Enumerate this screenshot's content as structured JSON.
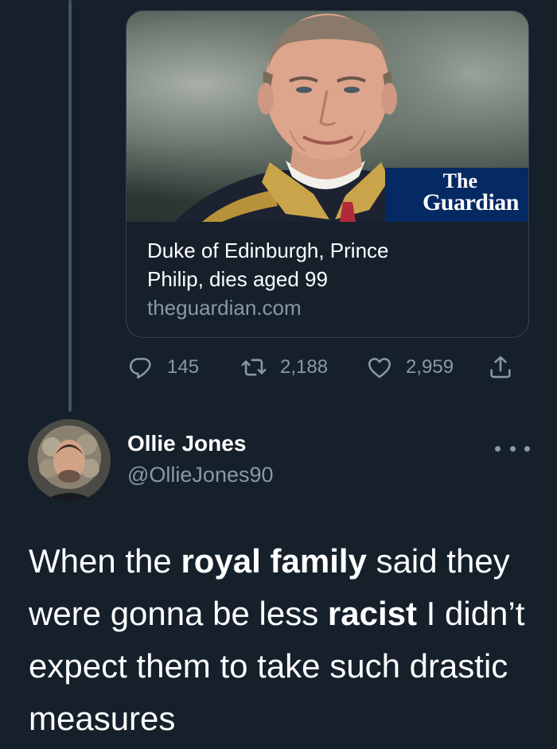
{
  "link_card": {
    "title_line1": "Duke of Edinburgh, Prince",
    "title_line2": "Philip, dies aged 99",
    "domain": "theguardian.com",
    "logo_the": "The",
    "logo_guardian": "Guardian",
    "logo_color": "#052962"
  },
  "actions": {
    "reply_count": "145",
    "retweet_count": "2,188",
    "like_count": "2,959",
    "icons": [
      "reply-icon",
      "retweet-icon",
      "like-icon",
      "share-icon"
    ]
  },
  "reply_tweet": {
    "display_name": "Ollie Jones",
    "handle": "@OllieJones90",
    "text_parts": [
      "When the ",
      "royal family",
      " said they were gonna be less ",
      "racist",
      " I didn’t expect them to take such drastic measures"
    ]
  },
  "colors": {
    "background": "#15202b",
    "secondary_text": "#8899a6",
    "border": "#38444d"
  }
}
